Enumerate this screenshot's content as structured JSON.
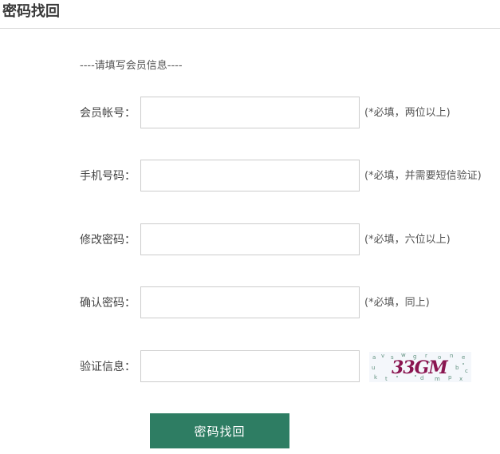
{
  "page": {
    "title": "密码找回"
  },
  "form": {
    "section_hint": "----请填写会员信息----",
    "fields": [
      {
        "label": "会员帐号：",
        "value": "",
        "placeholder": "",
        "hint": "(*必填，两位以上)"
      },
      {
        "label": "手机号码：",
        "value": "",
        "placeholder": "",
        "hint": "(*必填，并需要短信验证)"
      },
      {
        "label": "修改密码：",
        "value": "",
        "placeholder": "",
        "hint": "(*必填，六位以上)"
      },
      {
        "label": "确认密码：",
        "value": "",
        "placeholder": "",
        "hint": "(*必填，同上)"
      },
      {
        "label": "验证信息：",
        "value": "",
        "placeholder": ""
      }
    ],
    "captcha": {
      "text": "33GM",
      "text_color": "#8a1550",
      "noise_color": "#2f6f55"
    },
    "submit_label": "密码找回"
  },
  "colors": {
    "accent": "#2e7d63",
    "border": "#cccccc",
    "rule": "#d9d9d9"
  }
}
